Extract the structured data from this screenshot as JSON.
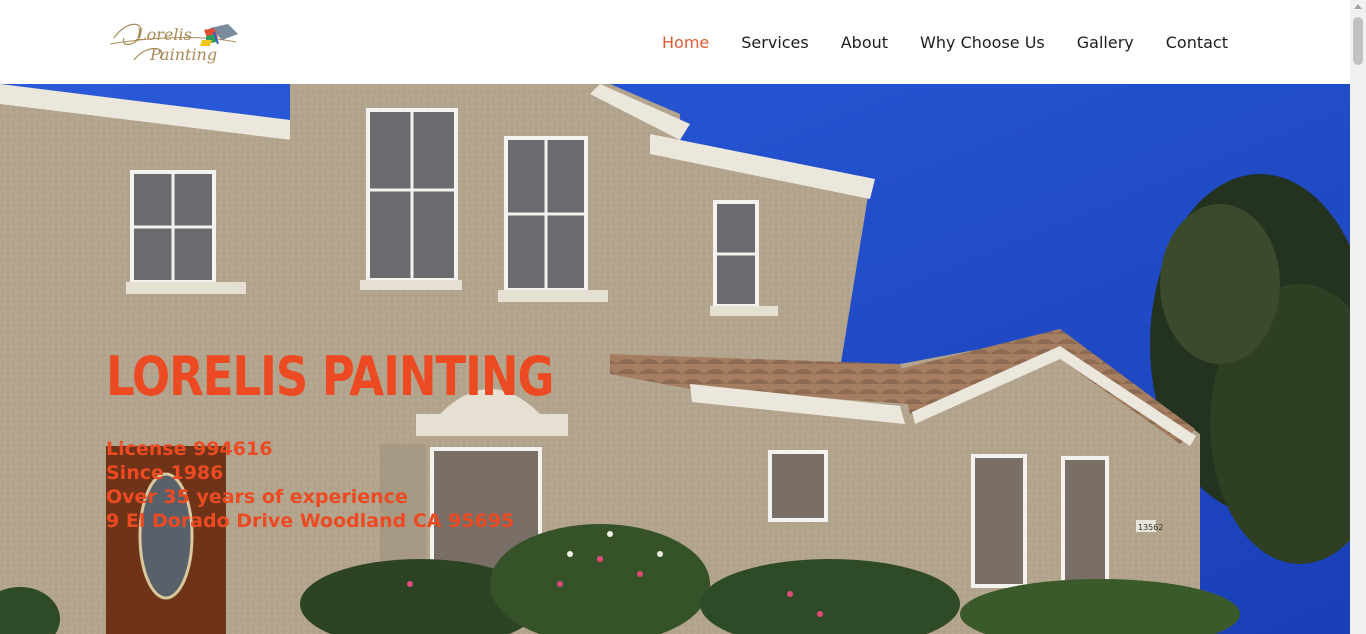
{
  "logo": {
    "text_line1": "Lorelis",
    "text_line2": "Painting",
    "icon": "paintbrush-logo"
  },
  "nav": {
    "items": [
      {
        "label": "Home",
        "active": true
      },
      {
        "label": "Services",
        "active": false
      },
      {
        "label": "About",
        "active": false
      },
      {
        "label": "Why Choose Us",
        "active": false
      },
      {
        "label": "Gallery",
        "active": false
      },
      {
        "label": "Contact",
        "active": false
      }
    ]
  },
  "hero": {
    "title": "Lorelis Painting",
    "lines": [
      "License 994616",
      "Since 1986",
      "Over 35 years of experience",
      "9 El Dorado Drive Woodland CA 95695"
    ],
    "house_number": "13562"
  },
  "colors": {
    "accent": "#ec4a22",
    "nav_active": "#e05a34",
    "sky": "#1f4bd0",
    "stucco": "#b3a58d"
  }
}
